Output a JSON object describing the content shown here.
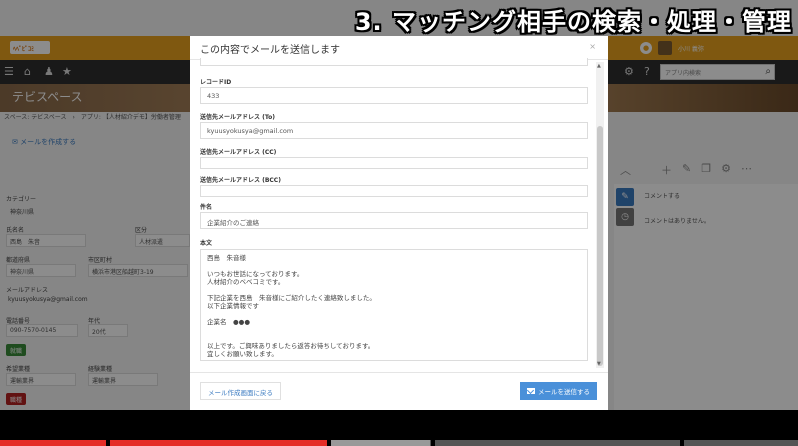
{
  "caption": "3. マッチング相手の検索・処理・管理",
  "app": {
    "logo_text": "ﾍﾍﾞﾋﾞｺﾐ",
    "user_name": "小川 義弥",
    "search_placeholder": "アプリ内検索",
    "space_title": "テビスペース",
    "breadcrumb": "スペース: テビスペース　›　アプリ: 【人材紹介デモ】労働者管理",
    "create_mail_label": "メールを作成する",
    "comment_label": "コメントする",
    "no_comments": "コメントはありません。",
    "fields": {
      "category_label": "カテゴリー",
      "category_value": "神奈川県",
      "name_label": "氏名名",
      "name_value": "西島　朱音",
      "kubun_label": "区分",
      "kubun_value": "人材派遣",
      "pref_label": "都道府県",
      "pref_value": "神奈川県",
      "city_label": "市区町村",
      "city_value": "横浜市港区船越町3-19",
      "email_label": "メールアドレス",
      "email_value": "kyuusyokusya@gmail.com",
      "phone_label": "電話番号",
      "phone_value": "090-7570-0145",
      "age_label": "年代",
      "age_value": "20代",
      "status1": "就職",
      "desired_label": "希望業種",
      "desired_value": "運輸業界",
      "exp_label": "経験業種",
      "exp_value": "運輸業界",
      "status2": "職種"
    }
  },
  "modal": {
    "title": "この内容でメールを送信します",
    "close": "×",
    "record_id_label": "レコードID",
    "record_id_value": "433",
    "to_label": "送信先メールアドレス (To)",
    "to_value": "kyuusyokusya@gmail.com",
    "cc_label": "送信先メールアドレス (CC)",
    "cc_value": "",
    "bcc_label": "送信先メールアドレス (BCC)",
    "bcc_value": "",
    "subject_label": "件名",
    "subject_value": "企業紹介のご連絡",
    "body_label": "本文",
    "body_lines": [
      "西島　朱音様",
      "",
      "いつもお世話になっております。",
      "人材紹介のベベコミです。",
      "",
      "下記企業を西島　朱音様にご紹介したく連絡致しました。",
      "以下企業情報です",
      "",
      "企業名　●●●",
      "",
      "",
      "以上です。ご興味ありましたら返答お待ちしております。",
      "宜しくお願い致します。"
    ],
    "back_button": "メール作成画面に戻る",
    "send_button": "メールを送信する"
  },
  "video": {
    "progress_percent": 41
  },
  "colors": {
    "brand": "#e7a11e",
    "accent": "#4a90d9",
    "danger": "#b22222",
    "success": "#3a8a3a"
  }
}
